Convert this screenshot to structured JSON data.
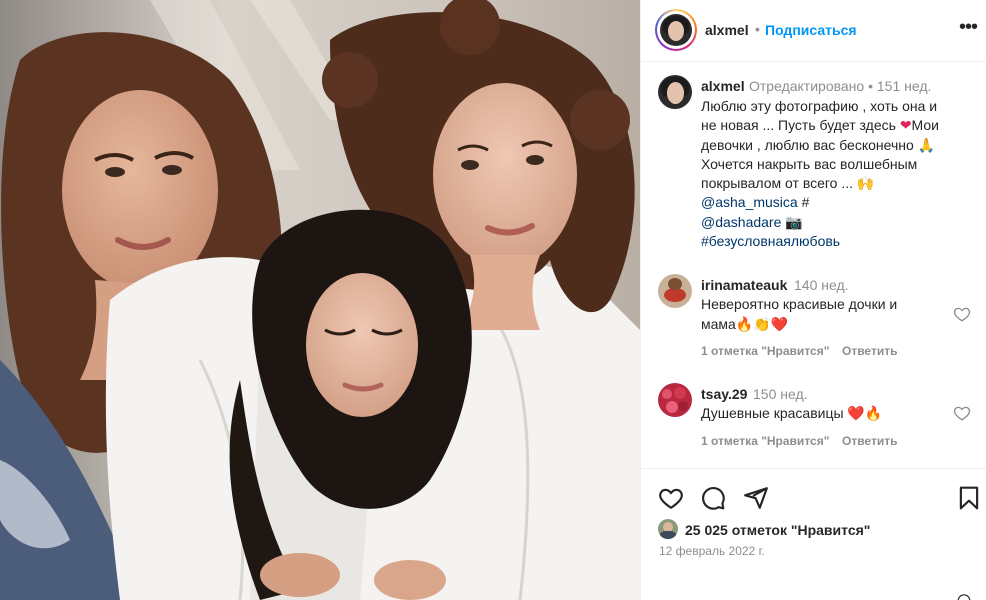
{
  "post": {
    "username": "alxmel",
    "follow_label": "Подписаться",
    "dot": "•",
    "more_label": "•••",
    "caption": {
      "username": "alxmel",
      "edited_meta": "Отредактировано •  151 нед.",
      "lines": [
        "Люблю эту фотографию , хоть она и",
        "не новая ... Пусть будет здесь ",
        "девочки , люблю вас бесконечно 🙏",
        "Хочется накрыть вас волшебным",
        "покрывалом от всего ... 🙌"
      ],
      "line2_tail": "Мои",
      "heart_glyph": "❤",
      "mentions": [
        "@asha_musica",
        "@dashadare"
      ],
      "mention1_suffix": " #",
      "mention2_suffix": " 📷",
      "hashtag": "#безусловнаялюбовь"
    },
    "comments": [
      {
        "username": "irinamateauk",
        "time": "140 нед.",
        "lines": [
          "Невероятно красивые дочки и",
          "мама🔥👏❤️"
        ],
        "likes_label": "1 отметка \"Нравится\"",
        "reply_label": "Ответить"
      },
      {
        "username": "tsay.29",
        "time": "150 нед.",
        "lines": [
          "Душевные красавицы ❤️🔥"
        ],
        "likes_label": "1 отметка \"Нравится\"",
        "reply_label": "Ответить"
      }
    ],
    "likes_text": "25 025 отметок \"Нравится\"",
    "date": "12 февраль 2022 г."
  },
  "icons": {
    "like": "heart-outline-icon",
    "comment": "speech-bubble-icon",
    "share": "paper-plane-icon",
    "save": "bookmark-icon",
    "more": "more-horizontal-icon"
  },
  "colors": {
    "link": "#00376b",
    "follow": "#0095f6",
    "secondary_text": "#8e8e8e",
    "divider": "#efefef"
  }
}
